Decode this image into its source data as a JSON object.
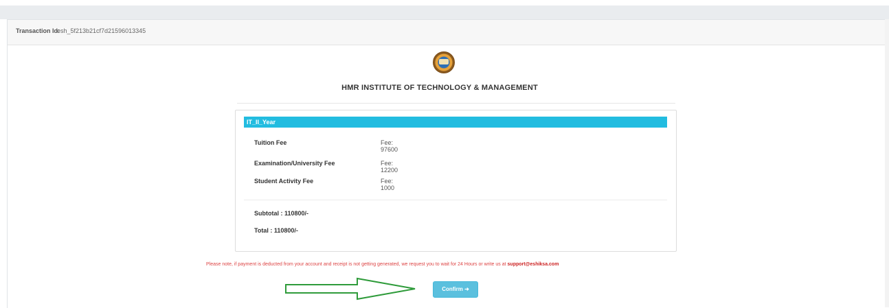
{
  "transaction": {
    "label": "Transaction Id:",
    "value": "esh_5f213b21cf7d21596013345"
  },
  "institution": {
    "name": "HMR INSTITUTE OF TECHNOLOGY & MANAGEMENT",
    "logo_icon": "institute-seal"
  },
  "fee_card": {
    "header": "IT_II_Year",
    "items": [
      {
        "name": "Tuition Fee",
        "amount": "Fee: 97600"
      },
      {
        "name": "Examination/University Fee",
        "amount": "Fee: 12200"
      },
      {
        "name": "Student Activity Fee",
        "amount": "Fee: 1000"
      }
    ],
    "subtotal": "Subtotal : 110800/-",
    "total": "Total : 110800/-"
  },
  "notice": {
    "text": "Please note, if payment is deducted from your account and receipt is not getting generated, we request you to wait for 24 Hours or write us at",
    "email": "support@eshiksa.com"
  },
  "actions": {
    "confirm_label": "Confirm ➜"
  },
  "colors": {
    "header_bg": "#22bce0",
    "confirm_bg": "#5bc0de",
    "notice_text": "#d44444",
    "arrow": "#2e9b3a"
  }
}
